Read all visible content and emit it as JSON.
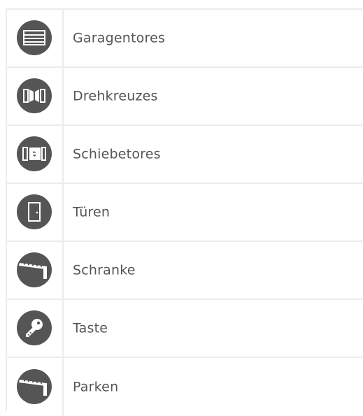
{
  "items": [
    {
      "label": "Garagentores",
      "icon": "garage-door-icon"
    },
    {
      "label": "Drehkreuzes",
      "icon": "swing-gate-icon"
    },
    {
      "label": "Schiebetores",
      "icon": "sliding-gate-icon"
    },
    {
      "label": "Türen",
      "icon": "door-icon"
    },
    {
      "label": "Schranke",
      "icon": "barrier-icon"
    },
    {
      "label": "Taste",
      "icon": "key-icon"
    },
    {
      "label": "Parken",
      "icon": "parking-barrier-icon"
    }
  ],
  "colors": {
    "icon_bg": "#555555",
    "divider": "#ececec",
    "text": "#555555"
  }
}
